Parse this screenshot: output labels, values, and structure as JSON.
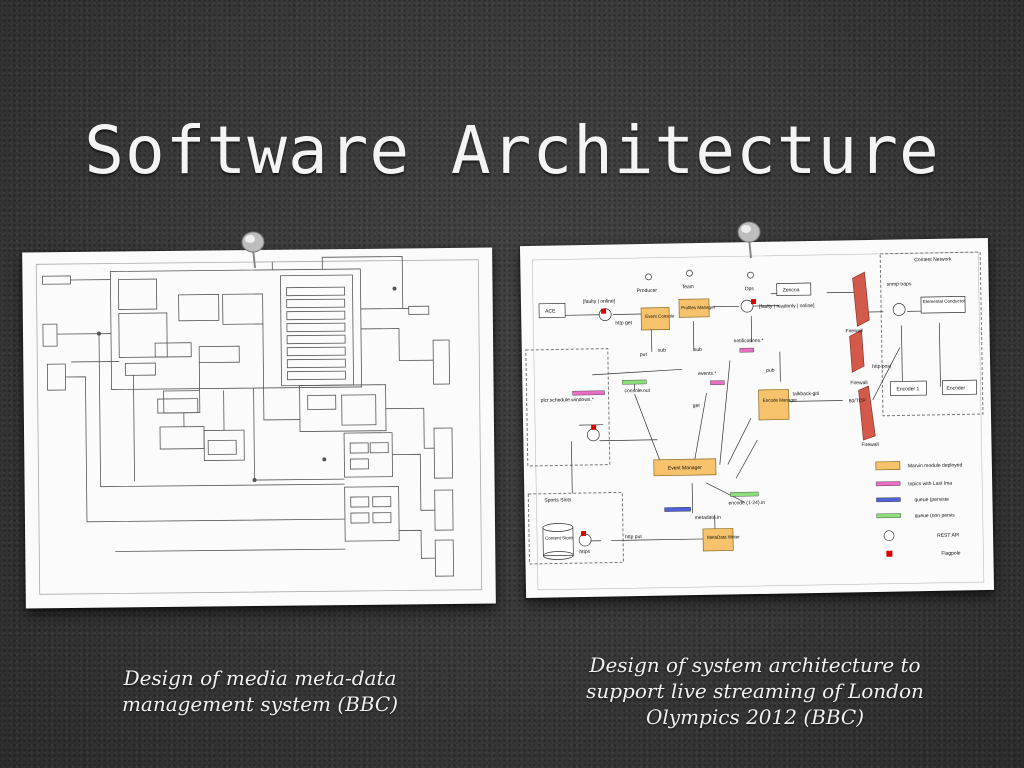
{
  "slide": {
    "title": "Software Architecture"
  },
  "captions": {
    "left": "Design of media meta-data management system (BBC)",
    "right": "Design of system architecture to support live streaming of London Olympics 2012 (BBC)"
  },
  "diagram_right": {
    "producer": "Producer",
    "team": "Team",
    "ops": "Ops",
    "ace": "ACE",
    "faulty_online_1": "[faulty | online]",
    "http_get": "http get",
    "event_console": "Event Console",
    "profiles_manager": "Profiles Manager",
    "faulty_readonly": "[faulty | readonly | online]",
    "zencoa": "Zencoa",
    "content_network": "Content Network",
    "snmp_traps": "snmp traps",
    "elemental_conductor": "Elemental Conductor",
    "firewall": "Firewall",
    "http_post": "http post",
    "encoder_1": "Encoder 1",
    "encoder": "Encoder",
    "notifications": "notifications.*",
    "events": "events.*",
    "put": "put",
    "sub": "sub",
    "pub": "pub",
    "get": "get",
    "console_out": "console.out",
    "plcr_schedule": "plcr.schedule.windows.*",
    "encode_manager": "Encode Manager",
    "talkback": "talkback-giti",
    "tcp": "80/TCP",
    "event_manager": "Event Manager",
    "encode_in": "encode.(1-24).in",
    "metadata_in": "metadata.in",
    "metadata_writer": "MetaData Writer",
    "sports_slots": "Sports Slots",
    "content_store": "Content Store",
    "https": "https",
    "http_put": "http put",
    "legend_marvin": "Marvin module deployed",
    "legend_topics": "topics with Last Ima",
    "legend_queue_persist": "queue (persiste",
    "legend_queue_non": "queue (non persis",
    "legend_rest": "REST API",
    "legend_flag": "Flagpole"
  }
}
